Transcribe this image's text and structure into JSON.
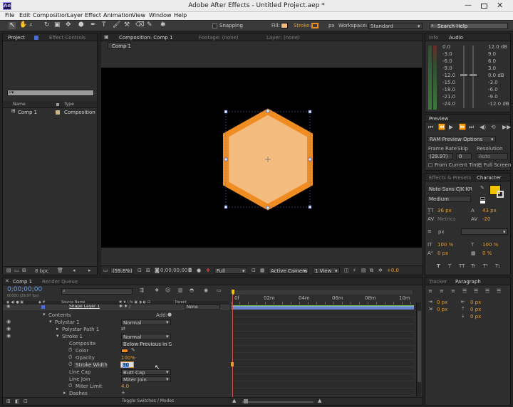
{
  "titlebar": {
    "app_badge": "Ae",
    "title": "Adobe After Effects - Untitled Project.aep *"
  },
  "menu": [
    "File",
    "Edit",
    "Composition",
    "Layer",
    "Effect",
    "Animation",
    "View",
    "Window",
    "Help"
  ],
  "toolbar": {
    "snapping": "Snapping",
    "fill": "Fill:",
    "stroke": "Stroke:",
    "px": "px",
    "workspace_label": "Workspace:",
    "workspace": "Standard",
    "search": "Search Help"
  },
  "project": {
    "tabs": [
      "Project",
      "Effect Controls"
    ],
    "columns": [
      "Name",
      "Type"
    ],
    "items": [
      {
        "name": "Comp 1",
        "type": "Composition"
      }
    ],
    "bpc": "8 bpc"
  },
  "comp": {
    "tabs": [
      "Composition: Comp 1",
      "Footage: (none)",
      "Layer: (none)"
    ],
    "chip": "Comp 1",
    "zoom": "(59.8%)",
    "timecode": "0;00;00;00",
    "resolution": "Full",
    "camera": "Active Camera",
    "view": "1 View",
    "exposure": "+0.0"
  },
  "info": {
    "tabs": [
      "Info",
      "Audio"
    ],
    "left_scale": [
      "0.0",
      "-3.0",
      "-6.0",
      "-9.0",
      "-12.0",
      "-15.0",
      "-18.0",
      "-21.0",
      "-24.0"
    ],
    "right_scale": [
      "12.0 dB",
      "9.0",
      "6.0",
      "3.0",
      "0.0 dB",
      "-3.0",
      "-6.0",
      "-9.0",
      "-12.0 dB"
    ]
  },
  "preview": {
    "tab": "Preview",
    "ram": "RAM Preview Options",
    "frame_rate_label": "Frame Rate",
    "skip_label": "Skip",
    "resolution_label": "Resolution",
    "frame_rate": "(29.97)",
    "skip": "0",
    "resolution": "Auto",
    "from_current": "From Current Time",
    "full_screen": "Full Screen"
  },
  "character": {
    "tabs": [
      "Effects & Presets",
      "Character"
    ],
    "font": "Noto Sans CJK KR",
    "style": "Medium",
    "size": "36 px",
    "leading": "43 px",
    "kerning": "Metrics",
    "tracking": "-20",
    "stroke_unit": "px",
    "vscale": "100 %",
    "hscale": "100 %",
    "baseline": "0 px",
    "tsume": "0 %",
    "styles": [
      "T",
      "T",
      "TT",
      "Tr",
      "T¹",
      "T₁"
    ]
  },
  "paragraph": {
    "tabs": [
      "Tracker",
      "Paragraph"
    ],
    "values": [
      "0 px",
      "0 px",
      "0 px",
      "0 px",
      "0 px"
    ]
  },
  "timeline": {
    "tabs": [
      "Comp 1",
      "Render Queue"
    ],
    "timecode": "0;00;00;00",
    "fps": "00000 (29.97 fps)",
    "headers": {
      "source": "Source Name",
      "parent": "Parent"
    },
    "ruler": [
      "0f",
      "02m",
      "04m",
      "06m",
      "08m",
      "10m"
    ],
    "add": "Add:",
    "toggle": "Toggle Switches / Modes",
    "rows": [
      {
        "label": "Shape Layer 1",
        "indent": 0,
        "value": "None",
        "type": "layer"
      },
      {
        "label": "Contents",
        "indent": 1,
        "value": "",
        "type": "group"
      },
      {
        "label": "Polystar 1",
        "indent": 2,
        "value": "Normal",
        "type": "dropdown"
      },
      {
        "label": "Polystar Path 1",
        "indent": 3,
        "value": "",
        "type": "group"
      },
      {
        "label": "Stroke 1",
        "indent": 3,
        "value": "Normal",
        "type": "dropdown"
      },
      {
        "label": "Composite",
        "indent": 4,
        "value": "Below Previous in S",
        "type": "dropdown"
      },
      {
        "label": "Color",
        "indent": 4,
        "value": "",
        "type": "color"
      },
      {
        "label": "Opacity",
        "indent": 4,
        "value": "100%",
        "type": "orange"
      },
      {
        "label": "Stroke Width",
        "indent": 4,
        "value": "30",
        "type": "edit"
      },
      {
        "label": "Line Cap",
        "indent": 4,
        "value": "Butt Cap",
        "type": "dropdown"
      },
      {
        "label": "Line Join",
        "indent": 4,
        "value": "Miter Join",
        "type": "dropdown"
      },
      {
        "label": "Miter Limit",
        "indent": 4,
        "value": "4.0",
        "type": "orange"
      },
      {
        "label": "Dashes",
        "indent": 4,
        "value": "",
        "type": "plus"
      }
    ]
  },
  "colors": {
    "accent": "#e49b2a",
    "hex_fill": "#f4bb7e",
    "hex_stroke": "#f08d22",
    "swatch": "#f1c400"
  }
}
